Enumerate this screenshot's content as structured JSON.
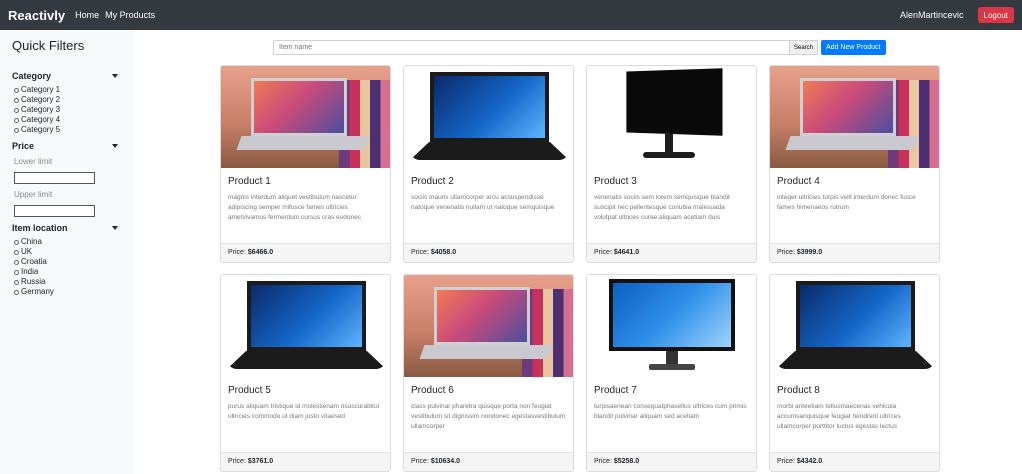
{
  "nav": {
    "brand": "Reactivly",
    "links": [
      "Home",
      "My Products"
    ],
    "username": "AlenMartincevic",
    "logout": "Logout"
  },
  "sidebar": {
    "title": "Quick Filters",
    "category_label": "Category",
    "categories": [
      "Category 1",
      "Category 2",
      "Category 3",
      "Category 4",
      "Category 5"
    ],
    "price_label": "Price",
    "lower_limit": "Lower limit",
    "upper_limit": "Upper limit",
    "location_label": "Item location",
    "locations": [
      "China",
      "UK",
      "Croatia",
      "India",
      "Russia",
      "Germany"
    ]
  },
  "search": {
    "placeholder": "Item name",
    "search_button": "Search",
    "add_button": "Add New Product"
  },
  "price_prefix": "Price: ",
  "products": [
    {
      "title": "Product 1",
      "desc": "magnis interdum aliquet vestibulum nascetur adipiscing semper mifusce fames ultricies ametvivamus fermentum cursus cras eudonec",
      "price": "$6466.0",
      "image": "silver-laptop"
    },
    {
      "title": "Product 2",
      "desc": "sociis mauris ullamcorper arcu acsuspendisse natoque venenatis nullam ut natoque semquisque",
      "price": "$4058.0",
      "image": "black-laptop"
    },
    {
      "title": "Product 3",
      "desc": "venenatis sociis sem lorem semquisque blandit suscipit nec pellentesque conubia malesuada volutpat ultrices curae;aliquam acetiam duis",
      "price": "$4641.0",
      "image": "black-monitor"
    },
    {
      "title": "Product 4",
      "desc": "integer ultricies turpis velit interdum donec fusce fames himenaeos rutrum",
      "price": "$3999.0",
      "image": "silver-laptop"
    },
    {
      "title": "Product 5",
      "desc": "purus aliquam tristique id molestienam risuscurabitur ultricies commodo ut diam justo vitaesed",
      "price": "$3761.0",
      "image": "black-laptop"
    },
    {
      "title": "Product 6",
      "desc": "class pulvinar pharetra quisque porta non feugiat vestibulum sit dignissim nondonec egestasvestibulum ullamcorper",
      "price": "$10634.0",
      "image": "silver-laptop"
    },
    {
      "title": "Product 7",
      "desc": "turpisaenean consequatphasellus ultrices cum primis blandit pulvinar aliquam sed acetiam",
      "price": "$5258.0",
      "image": "blue-monitor"
    },
    {
      "title": "Product 8",
      "desc": "morbi anteetiam tellusmaecenas vehicula accumsanquisque feugiat hendrerit ultrices ullamcorper porttitor luctus egestas lectus",
      "price": "$4342.0",
      "image": "black-laptop"
    }
  ]
}
